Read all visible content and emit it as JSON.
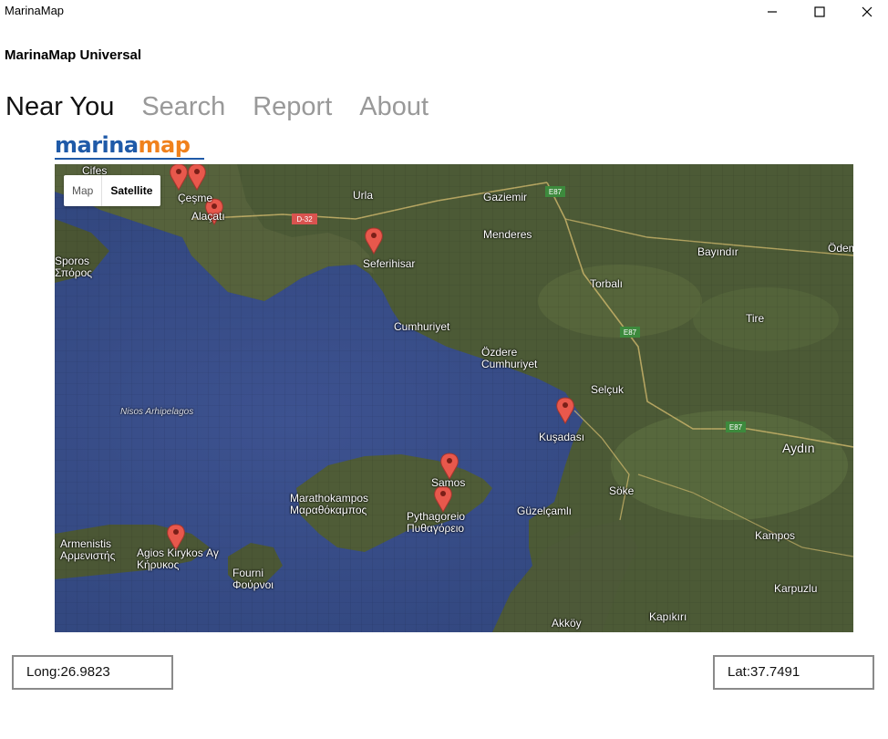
{
  "window": {
    "title": "MarinaMap"
  },
  "app": {
    "header": "MarinaMap Universal"
  },
  "tabs": [
    {
      "label": "Near You",
      "active": true
    },
    {
      "label": "Search",
      "active": false
    },
    {
      "label": "Report",
      "active": false
    },
    {
      "label": "About",
      "active": false
    }
  ],
  "logo": {
    "part1": "marina",
    "part2": "map"
  },
  "map": {
    "type_toggle": {
      "map_label": "Map",
      "satellite_label": "Satellite",
      "selected": "Satellite"
    },
    "places": [
      {
        "name": "Cifes"
      },
      {
        "name": "Çeşme"
      },
      {
        "name": "Alaçatı"
      },
      {
        "name": "Urla"
      },
      {
        "name": "Gaziemir"
      },
      {
        "name": "Menderes"
      },
      {
        "name": "Seferihisar"
      },
      {
        "name": "Bayındır"
      },
      {
        "name": "Ödemiş"
      },
      {
        "name": "Torbalı"
      },
      {
        "name": "Tire"
      },
      {
        "name": "Cumhuriyet"
      },
      {
        "name": "Özdere Cumhuriyet"
      },
      {
        "name": "Selçuk"
      },
      {
        "name": "Kuşadası"
      },
      {
        "name": "Aydın"
      },
      {
        "name": "Samos"
      },
      {
        "name": "Söke"
      },
      {
        "name": "Marathokampos Μαραθόκαμπος"
      },
      {
        "name": "Pythagoreio Πυθαγόρειο"
      },
      {
        "name": "Güzelçamlı"
      },
      {
        "name": "Armenistis Αρμενιστής"
      },
      {
        "name": "Agios Kirykos Αγ Κήρυκος"
      },
      {
        "name": "Fourni Φούρνοι"
      },
      {
        "name": "Kampos"
      },
      {
        "name": "Karpuzlu"
      },
      {
        "name": "Akköy"
      },
      {
        "name": "Kapıkırı"
      },
      {
        "name": "Sporos Σπόρος"
      },
      {
        "name": "Nisos Arhipelagos"
      }
    ],
    "road_labels": [
      "E87",
      "E87",
      "E87",
      "D-32"
    ],
    "marker_color": "#e8584c",
    "markers_count": 8
  },
  "coordinates": {
    "long": "Long:26.9823",
    "lat": "Lat:37.7491"
  },
  "colors": {
    "sea": "#3a4f8a",
    "land": "#4a5a34",
    "logo_blue": "#1f5aa8",
    "logo_orange": "#f0811c"
  }
}
